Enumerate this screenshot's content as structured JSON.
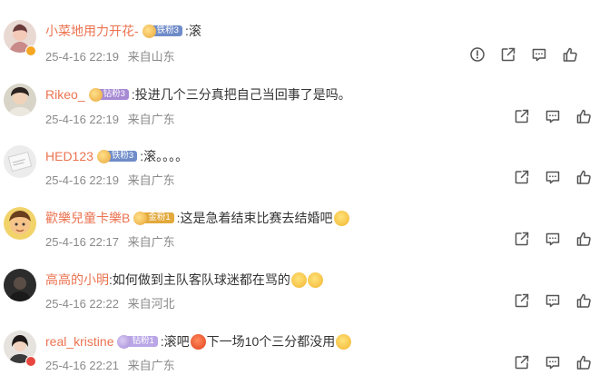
{
  "comments": [
    {
      "username": "小菜地用力开花-",
      "badge_label": "铁粉3",
      "text": ":滚",
      "date": "25-4-16 22:19",
      "location": "来自山东",
      "has_report": true
    },
    {
      "username": "Rikeo_",
      "badge_label": "钻粉3",
      "text": ":投进几个三分真把自己当回事了是吗。",
      "date": "25-4-16 22:19",
      "location": "来自广东",
      "has_report": false
    },
    {
      "username": "HED123",
      "badge_label": "铁粉3",
      "text": ":滚。。。。",
      "date": "25-4-16 22:19",
      "location": "来自广东",
      "has_report": false
    },
    {
      "username": "歡樂兒童卡樂B",
      "badge_label": "金粉1",
      "text": ":这是急着结束比赛去结婚吧",
      "date": "25-4-16 22:17",
      "location": "来自广东",
      "has_report": false
    },
    {
      "username": "高高的小明",
      "badge_label": "",
      "text": ":如何做到主队客队球迷都在骂的",
      "date": "25-4-16 22:22",
      "location": "来自河北",
      "has_report": false
    },
    {
      "username": "real_kristine",
      "badge_label": "钻粉1",
      "text_before": ":滚吧",
      "text_after": "下一场10个三分都没用",
      "date": "25-4-16 22:21",
      "location": "来自广东",
      "has_report": false
    }
  ],
  "colors": {
    "username": "#eb7350",
    "text": "#333333",
    "meta": "#8a8a8a",
    "icon": "#555555",
    "badge_iron": "#6f8cc9",
    "badge_diamond": "#a78ad4",
    "badge_gold": "#e3a93c",
    "badge_diamond_light": "#b9a6e6"
  },
  "icons": {
    "report": "report-icon",
    "share": "share-icon",
    "reply": "comment-icon",
    "like": "like-icon"
  }
}
